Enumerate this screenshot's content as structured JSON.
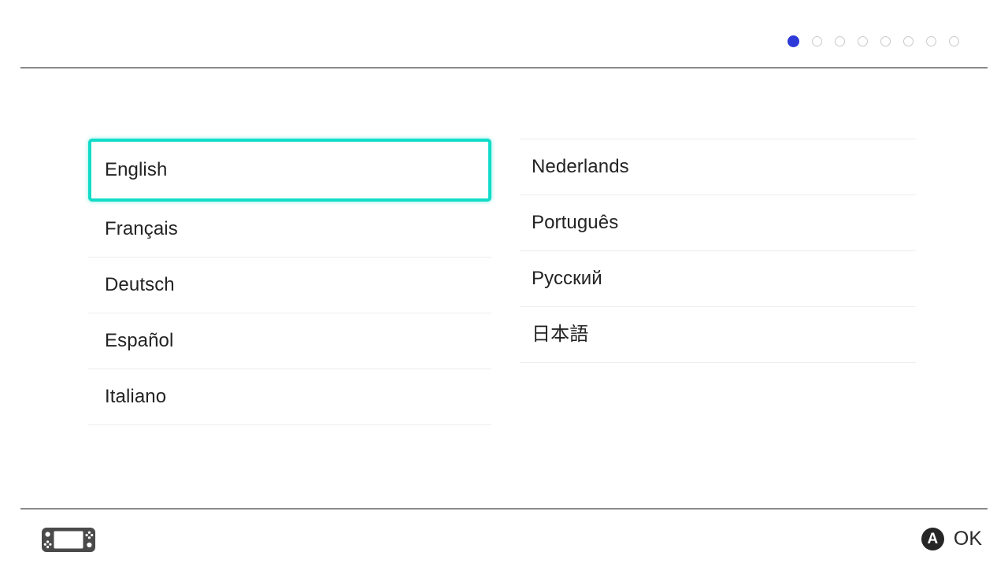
{
  "screen": {
    "name": "language-selection",
    "background_color": "#ffffff"
  },
  "pagination": {
    "total": 8,
    "current": 1,
    "active_color": "#2d3ad8",
    "inactive_color": "#c9c9c9",
    "dots": [
      {
        "state": "active"
      },
      {
        "state": "inactive"
      },
      {
        "state": "inactive"
      },
      {
        "state": "inactive"
      },
      {
        "state": "inactive"
      },
      {
        "state": "inactive"
      },
      {
        "state": "inactive"
      },
      {
        "state": "inactive"
      }
    ]
  },
  "languages": {
    "selected": "English",
    "selection_color": "#12dcc8",
    "left_column": [
      {
        "label": "English",
        "selected": true
      },
      {
        "label": "Français",
        "selected": false
      },
      {
        "label": "Deutsch",
        "selected": false
      },
      {
        "label": "Español",
        "selected": false
      },
      {
        "label": "Italiano",
        "selected": false
      }
    ],
    "right_column": [
      {
        "label": "Nederlands",
        "selected": false
      },
      {
        "label": "Português",
        "selected": false
      },
      {
        "label": "Русский",
        "selected": false
      },
      {
        "label": "日本語",
        "selected": false
      }
    ]
  },
  "footer": {
    "console_icon": "nintendo-switch-console-icon",
    "button_glyph": "A",
    "confirm_label": "OK"
  }
}
